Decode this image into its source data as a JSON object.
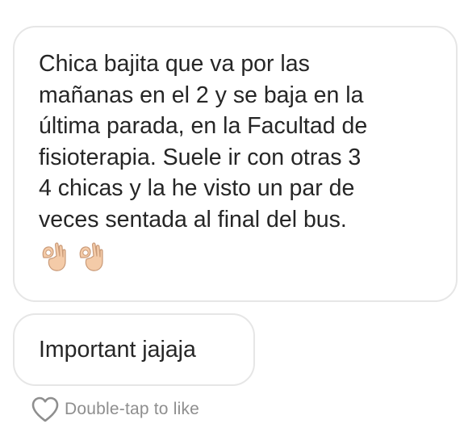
{
  "message": {
    "lines": [
      "Chica bajita que va por las",
      "mañanas en el 2 y se baja en la",
      "última parada, en la Facultad de",
      "fisioterapia. Suele ir con otras 3",
      "4 chicas y la he visto un par de",
      "veces sentada al final del bus."
    ],
    "emoji_icons": [
      "ok-hand-icon",
      "ok-hand-icon"
    ],
    "emoji_glyphs": [
      "👌🏼",
      "👌🏼"
    ]
  },
  "reply": {
    "text": "Important jajaja"
  },
  "like": {
    "icon": "heart-outline-icon",
    "label": "Double-tap to like"
  },
  "colors": {
    "text": "#262626",
    "secondary_text": "#8e8e8e",
    "bubble_border": "#e6e6e6",
    "background": "#ffffff",
    "emoji_skin": "#f4cba8"
  }
}
